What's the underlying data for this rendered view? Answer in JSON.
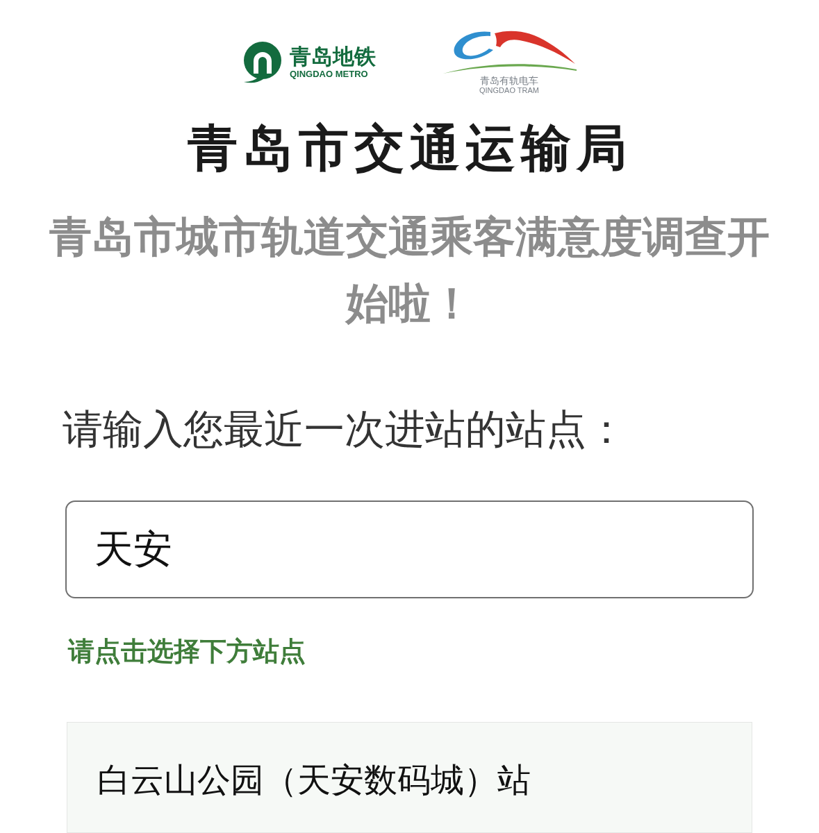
{
  "logos": [
    {
      "kind": "metro",
      "name": "青岛地铁",
      "name_en": "QINGDAO METRO"
    },
    {
      "kind": "tram",
      "name": "青岛有轨电车",
      "name_en": "QINGDAO TRAM"
    }
  ],
  "agency_title": "青岛市交通运输局",
  "headline": "青岛市城市轨道交通乘客满意度调查开始啦！",
  "question": {
    "label": "请输入您最近一次进站的站点：",
    "value": "天安",
    "hint": "请点击选择下方站点"
  },
  "suggestions": [
    {
      "label": "白云山公园（天安数码城）站"
    }
  ]
}
